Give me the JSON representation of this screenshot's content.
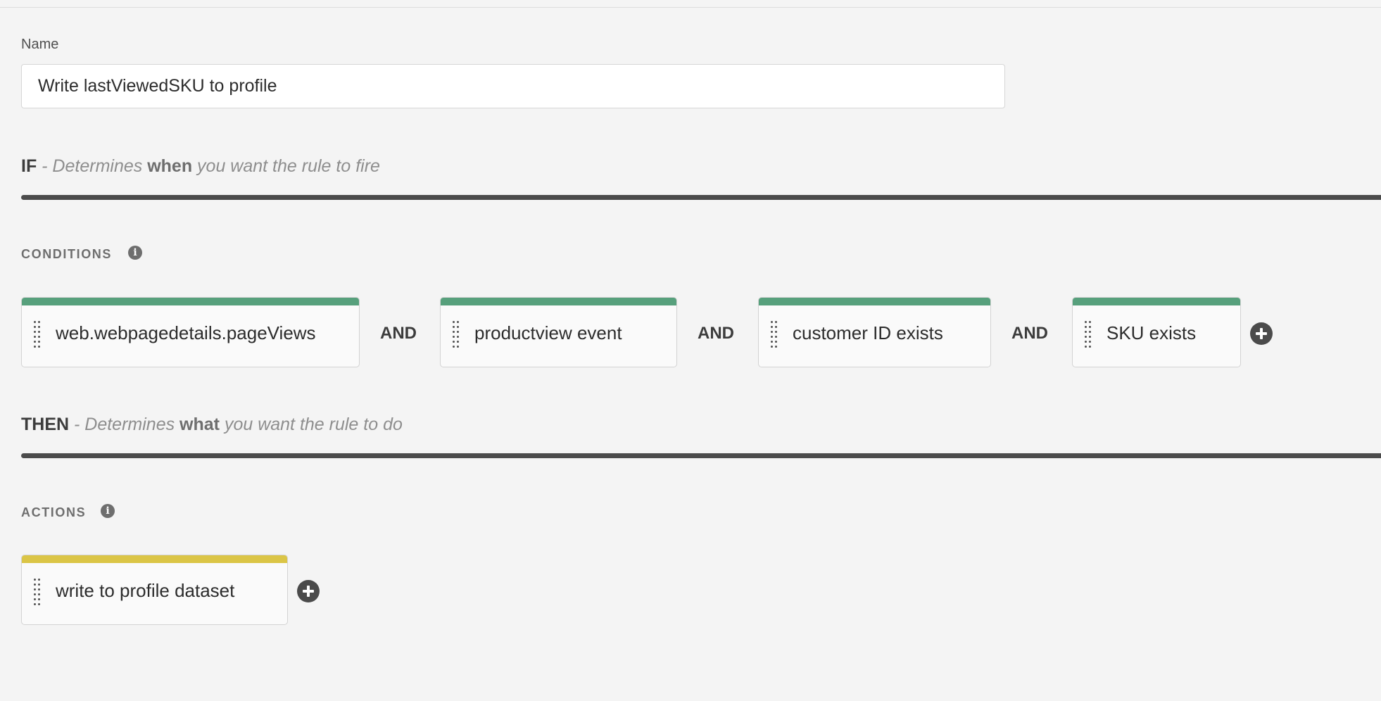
{
  "form": {
    "name_label": "Name",
    "name_value": "Write lastViewedSKU to profile"
  },
  "if_section": {
    "keyword": "IF",
    "desc_before": " - Determines ",
    "desc_bold": "when",
    "desc_after": " you want the rule to fire"
  },
  "conditions": {
    "label": "CONDITIONS",
    "info_icon": "info-icon",
    "items": [
      {
        "label": "web.webpagedetails.pageViews"
      },
      {
        "label": "productview event"
      },
      {
        "label": "customer ID exists"
      },
      {
        "label": "SKU exists"
      }
    ],
    "joiner": "AND",
    "add_icon": "plus-circle-icon",
    "accent_color": "#57a07c"
  },
  "then_section": {
    "keyword": "THEN",
    "desc_before": " - Determines ",
    "desc_bold": "what",
    "desc_after": " you want the rule to do"
  },
  "actions": {
    "label": "ACTIONS",
    "info_icon": "info-icon",
    "items": [
      {
        "label": "write to profile dataset"
      }
    ],
    "add_icon": "plus-circle-icon",
    "accent_color": "#dbc546"
  }
}
